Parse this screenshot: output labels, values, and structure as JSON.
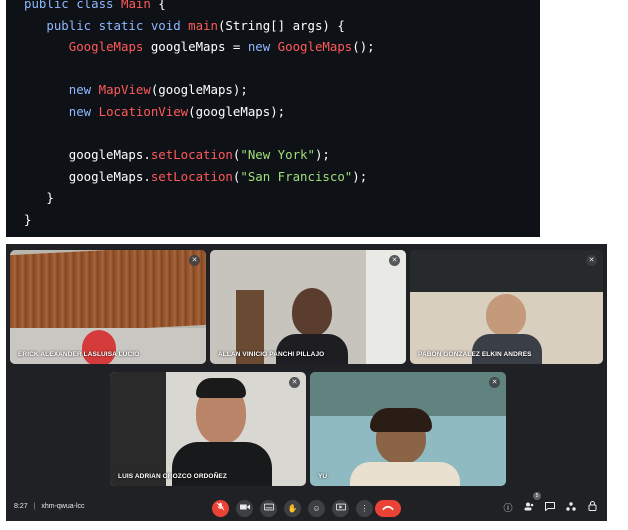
{
  "code": {
    "lines": [
      [
        {
          "t": "public class ",
          "c": "kw"
        },
        {
          "t": "Main",
          "c": "cls"
        },
        {
          "t": " {",
          "c": ""
        }
      ],
      [
        {
          "t": "   public static void ",
          "c": "kw"
        },
        {
          "t": "main",
          "c": "fn"
        },
        {
          "t": "(String[] args) {",
          "c": ""
        }
      ],
      [
        {
          "t": "      ",
          "c": ""
        },
        {
          "t": "GoogleMaps",
          "c": "cls"
        },
        {
          "t": " googleMaps = ",
          "c": ""
        },
        {
          "t": "new ",
          "c": "kw"
        },
        {
          "t": "GoogleMaps",
          "c": "cls"
        },
        {
          "t": "();",
          "c": ""
        }
      ],
      [
        {
          "t": "",
          "c": ""
        }
      ],
      [
        {
          "t": "      ",
          "c": ""
        },
        {
          "t": "new ",
          "c": "kw"
        },
        {
          "t": "MapView",
          "c": "cls"
        },
        {
          "t": "(googleMaps);",
          "c": ""
        }
      ],
      [
        {
          "t": "      ",
          "c": ""
        },
        {
          "t": "new ",
          "c": "kw"
        },
        {
          "t": "LocationView",
          "c": "cls"
        },
        {
          "t": "(googleMaps);",
          "c": ""
        }
      ],
      [
        {
          "t": "",
          "c": ""
        }
      ],
      [
        {
          "t": "      googleMaps.",
          "c": ""
        },
        {
          "t": "setLocation",
          "c": "fn"
        },
        {
          "t": "(",
          "c": ""
        },
        {
          "t": "\"New York\"",
          "c": "str"
        },
        {
          "t": ");",
          "c": ""
        }
      ],
      [
        {
          "t": "      googleMaps.",
          "c": ""
        },
        {
          "t": "setLocation",
          "c": "fn"
        },
        {
          "t": "(",
          "c": ""
        },
        {
          "t": "\"San Francisco\"",
          "c": "str"
        },
        {
          "t": ");",
          "c": ""
        }
      ],
      [
        {
          "t": "   }",
          "c": ""
        }
      ],
      [
        {
          "t": "}",
          "c": ""
        }
      ]
    ]
  },
  "meeting": {
    "time": "8:27",
    "separator": "|",
    "code": "xhm-qwua-lcc",
    "participants_badge": "5",
    "participants": [
      {
        "name": "ERICK ALEXANDER LASLUISA LUCIO"
      },
      {
        "name": "ALLAN VINICIO PANCHI PILLAJO"
      },
      {
        "name": "PABON GONZALEZ ELKIN ANDRES"
      },
      {
        "name": "LUIS ADRIAN OROZCO ORDOÑEZ"
      },
      {
        "name": "YU"
      }
    ]
  },
  "icons": {
    "mic_off": "mic-off-icon",
    "camera": "camera-icon",
    "captions": "captions-icon",
    "hand": "raise-hand-icon",
    "emoji": "emoji-icon",
    "present": "present-icon",
    "more": "more-vert-icon",
    "end": "end-call-icon",
    "info": "info-icon",
    "people": "people-icon",
    "chat": "chat-icon",
    "activities": "activities-icon",
    "lock": "host-controls-icon"
  }
}
